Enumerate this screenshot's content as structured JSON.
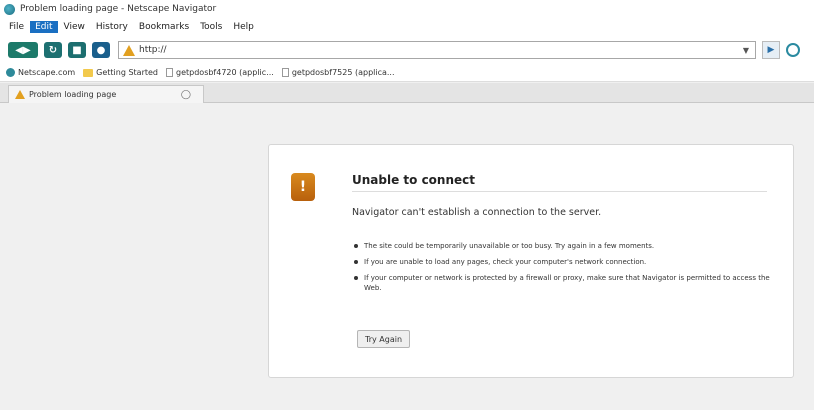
{
  "window": {
    "title": "Problem loading page - Netscape Navigator"
  },
  "menu": [
    "File",
    "Edit",
    "View",
    "History",
    "Bookmarks",
    "Tools",
    "Help"
  ],
  "navbar": {
    "url": "http://"
  },
  "bookmarks": [
    "Netscape.com",
    "Getting Started",
    "getpdosbf4720 (applic...",
    "getpdosbf7525 (applica..."
  ],
  "tab": {
    "title": "Problem loading page"
  },
  "error": {
    "title": "Unable to connect",
    "subtitle": "Navigator can't establish a connection to the server.",
    "bullets": [
      "The site could be temporarily unavailable or too busy. Try again in a few moments.",
      "If you are unable to load any pages, check your computer's network connection.",
      "If your computer or network is protected by a firewall or proxy, make sure that Navigator is permitted to access the Web."
    ],
    "button": "Try Again"
  },
  "colors": {
    "accent": "#1a6fc2",
    "toolbar_button": "#1c6e6f",
    "warning": "#e2a020",
    "error_icon": "#c8741a"
  }
}
